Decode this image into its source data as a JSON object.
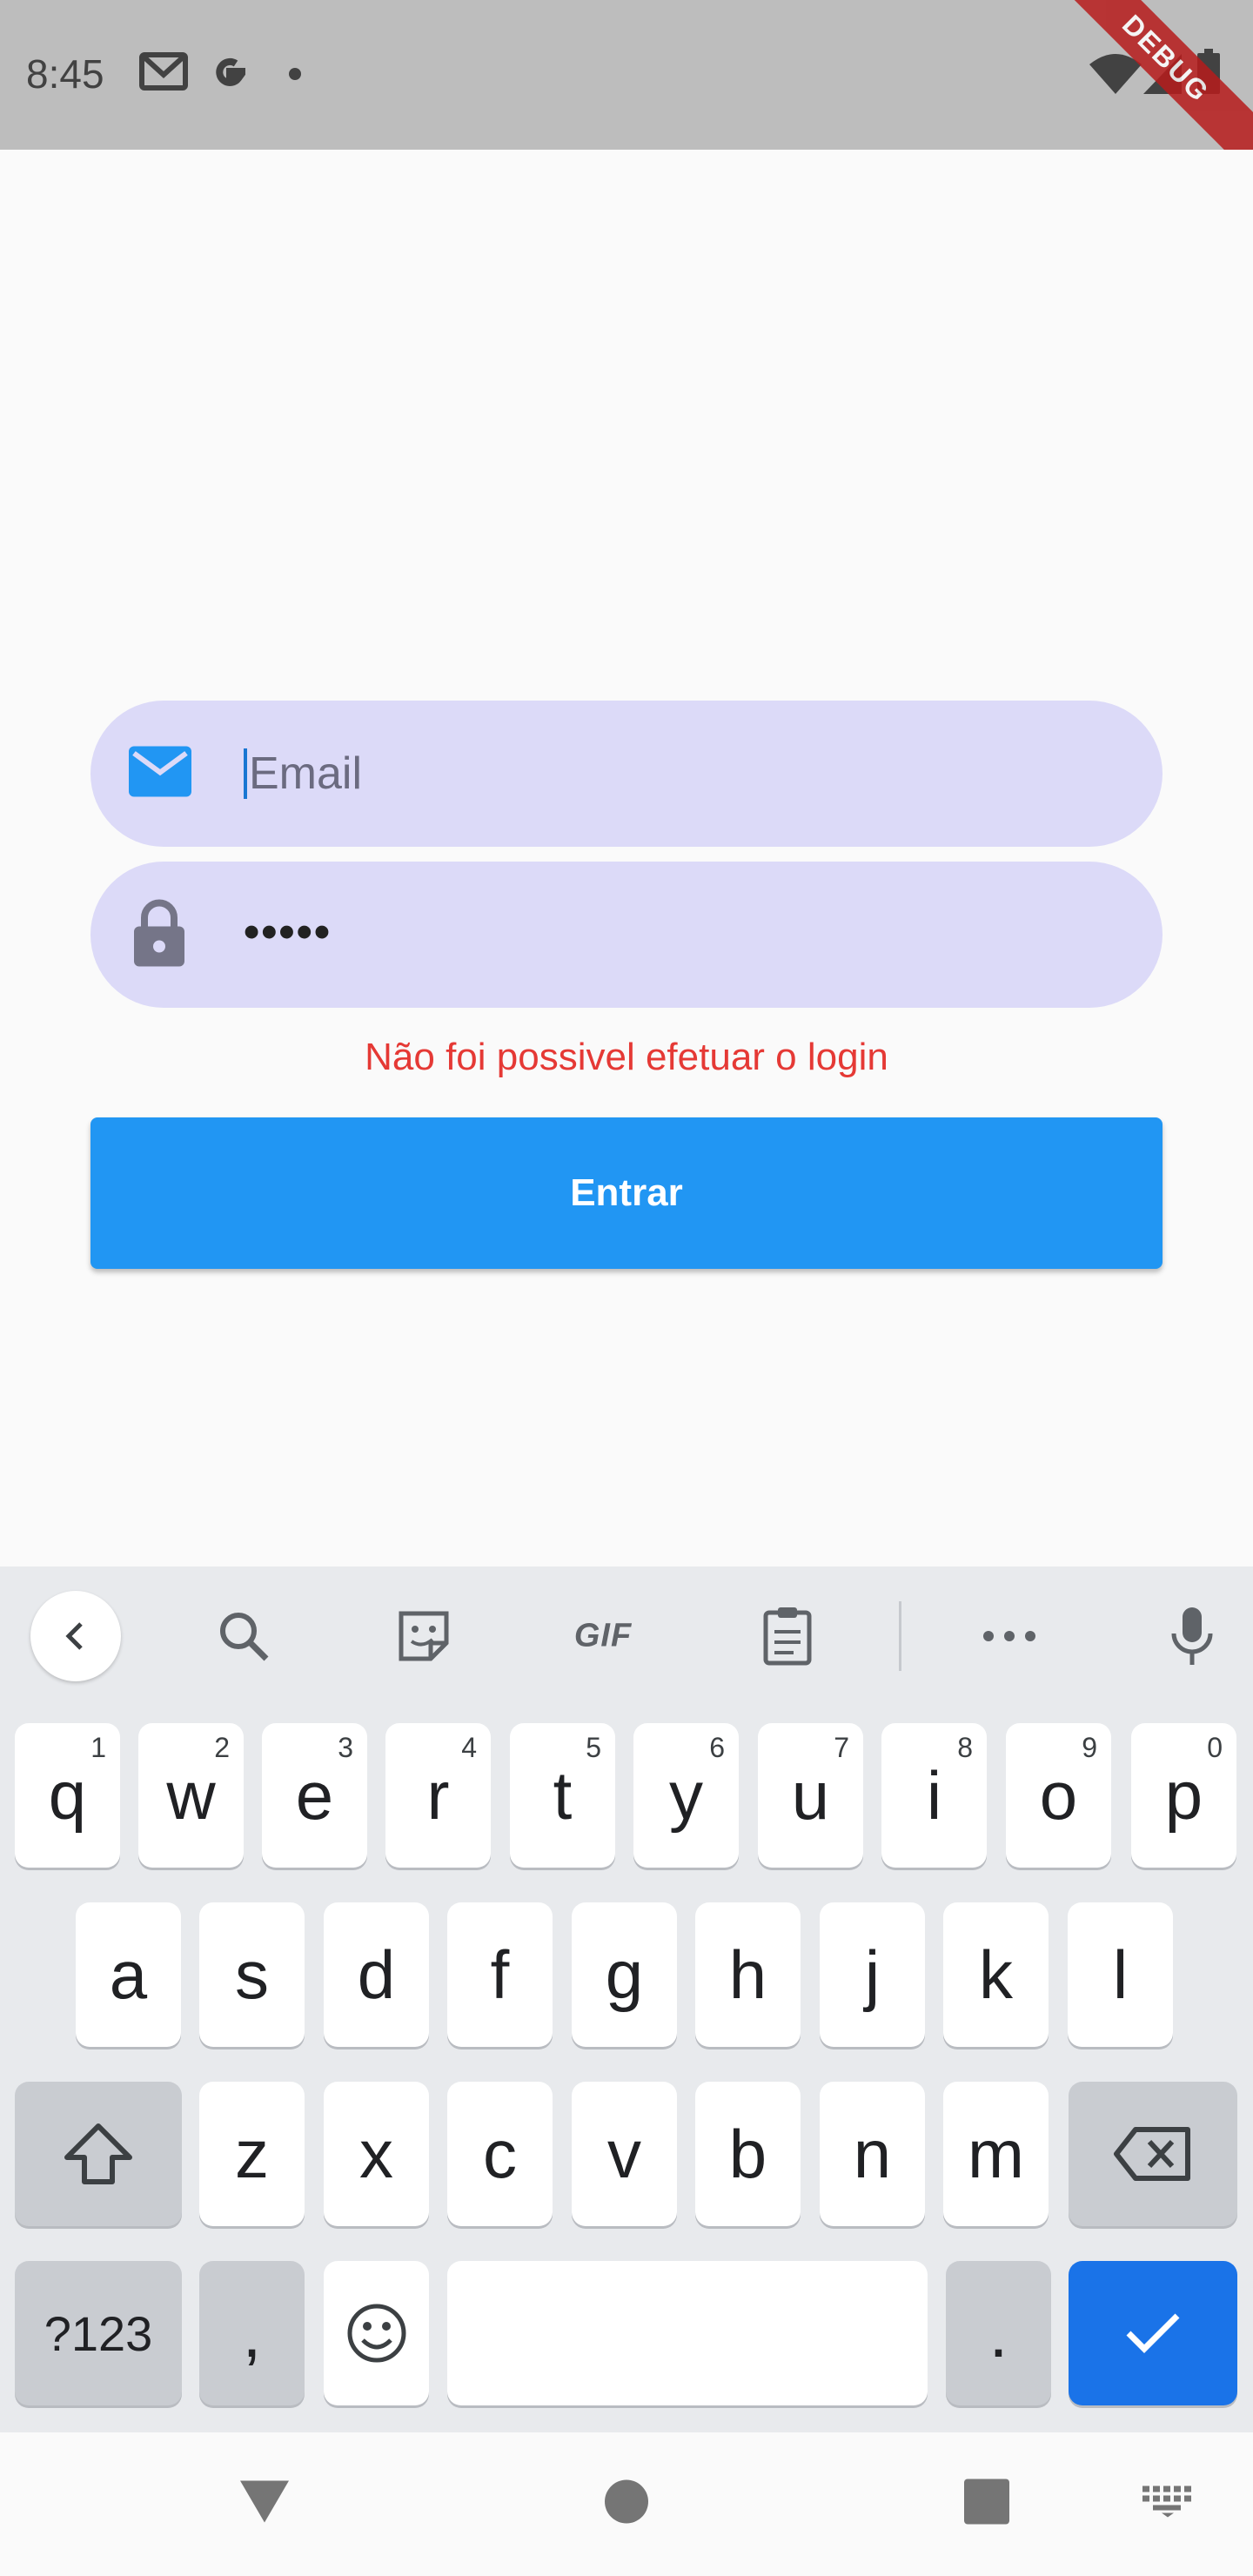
{
  "status_bar": {
    "time": "8:45",
    "debug_label": "DEBUG",
    "icons": [
      "gmail-icon",
      "google-icon",
      "notification-dot-icon",
      "wifi-icon",
      "signal-icon",
      "battery-icon"
    ]
  },
  "login": {
    "email_placeholder": "Email",
    "password_value": "•••••",
    "error_message": "Não foi possivel efetuar o login",
    "submit_label": "Entrar"
  },
  "keyboard": {
    "toolbar": [
      "back-icon",
      "search-icon",
      "sticker-icon",
      "gif",
      "clipboard-icon",
      "more-icon",
      "mic-icon"
    ],
    "gif_label": "GIF",
    "row1": [
      {
        "key": "q",
        "num": "1"
      },
      {
        "key": "w",
        "num": "2"
      },
      {
        "key": "e",
        "num": "3"
      },
      {
        "key": "r",
        "num": "4"
      },
      {
        "key": "t",
        "num": "5"
      },
      {
        "key": "y",
        "num": "6"
      },
      {
        "key": "u",
        "num": "7"
      },
      {
        "key": "i",
        "num": "8"
      },
      {
        "key": "o",
        "num": "9"
      },
      {
        "key": "p",
        "num": "0"
      }
    ],
    "row2": [
      "a",
      "s",
      "d",
      "f",
      "g",
      "h",
      "j",
      "k",
      "l"
    ],
    "row3": [
      "z",
      "x",
      "c",
      "v",
      "b",
      "n",
      "m"
    ],
    "symbols_label": "?123",
    "comma_label": ",",
    "period_label": "."
  },
  "colors": {
    "primary": "#2196f3",
    "field_bg": "#dcdaf8",
    "error": "#e53935",
    "keyboard_action": "#1a73e8"
  }
}
